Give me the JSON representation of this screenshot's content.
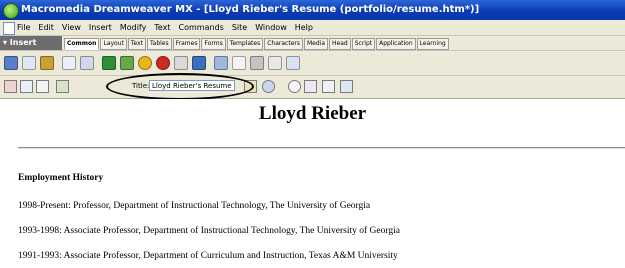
{
  "window": {
    "title": "Macromedia Dreamweaver MX - [Lloyd Rieber's Resume (portfolio/resume.htm*)]"
  },
  "menubar": {
    "items": [
      "File",
      "Edit",
      "View",
      "Insert",
      "Modify",
      "Text",
      "Commands",
      "Site",
      "Window",
      "Help"
    ]
  },
  "insertbar": {
    "label": "▾ Insert",
    "tabs": [
      "Common",
      "Layout",
      "Text",
      "Tables",
      "Frames",
      "Forms",
      "Templates",
      "Characters",
      "Media",
      "Head",
      "Script",
      "Application",
      "Learning"
    ],
    "active_tab": "Common"
  },
  "toolbar": {
    "title_label": "Title:",
    "title_value": "Lloyd Rieber's Resume"
  },
  "document": {
    "heading": "Lloyd Rieber",
    "section_title": "Employment History",
    "entries": [
      "1998-Present: Professor, Department of Instructional Technology, The University of Georgia",
      "1993-1998: Associate Professor, Department of Instructional Technology, The University of Georgia",
      "1991-1993: Associate Professor, Department of Curriculum and Instruction, Texas A&M University"
    ]
  },
  "colors": {
    "titlebar": "#0a3bb6",
    "chrome": "#ece9d8",
    "insert_label_bg": "#6d6d6d",
    "annotation": "#000000"
  }
}
